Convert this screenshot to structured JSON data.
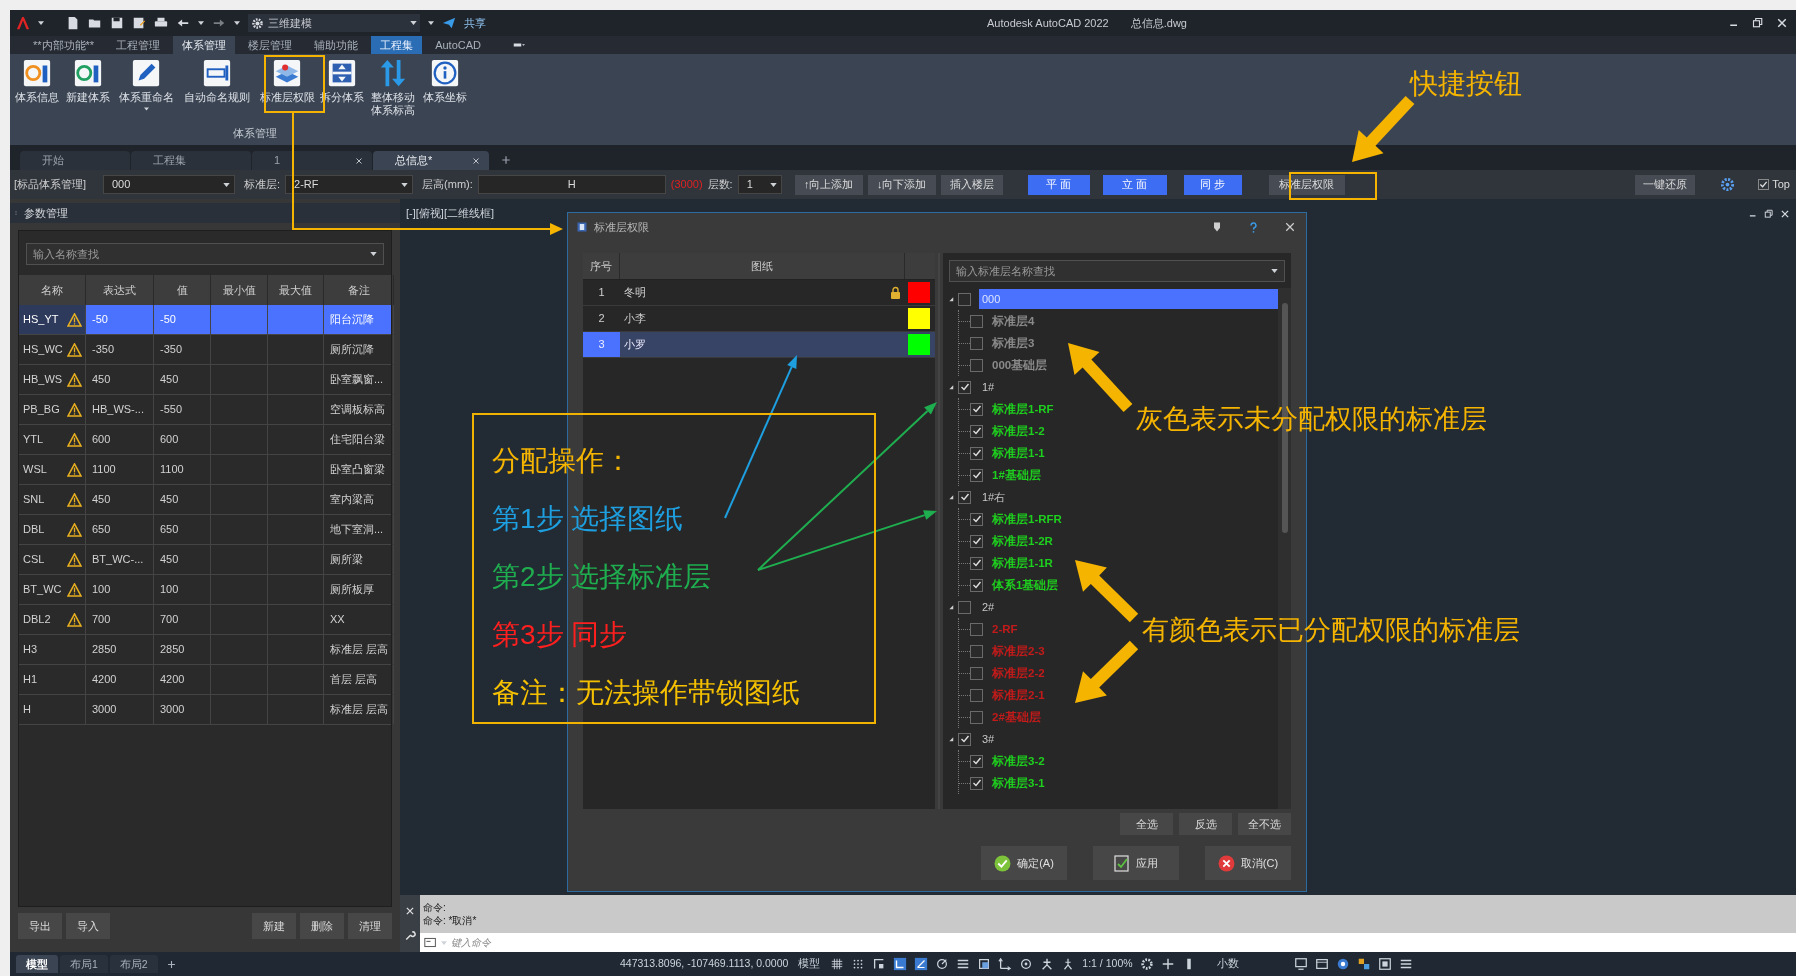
{
  "title_bar": {
    "workspace": "三维建模",
    "share": "共享",
    "title": "Autodesk AutoCAD 2022",
    "file": "总信息.dwg"
  },
  "ribbon_tabs": [
    {
      "label": "**内部功能**",
      "selected": false,
      "kind": "normal"
    },
    {
      "label": "工程管理",
      "selected": false,
      "kind": "normal"
    },
    {
      "label": "体系管理",
      "selected": true,
      "kind": "normal"
    },
    {
      "label": "楼层管理",
      "selected": false,
      "kind": "normal"
    },
    {
      "label": "辅助功能",
      "selected": false,
      "kind": "normal"
    },
    {
      "label": "工程集",
      "selected": false,
      "kind": "contextual"
    },
    {
      "label": "AutoCAD",
      "selected": false,
      "kind": "normal"
    }
  ],
  "ribbon_panel": {
    "title": "体系管理",
    "buttons": [
      {
        "label": "体系信息",
        "dropdown": false
      },
      {
        "label": "新建体系",
        "dropdown": false
      },
      {
        "label": "体系重命名",
        "dropdown": true
      },
      {
        "label": "自动命名规则",
        "dropdown": false
      },
      {
        "label": "标准层权限",
        "dropdown": false
      },
      {
        "label": "拆分体系",
        "dropdown": false
      },
      {
        "label": "整体移动体系标高",
        "dropdown": false
      },
      {
        "label": "体系坐标",
        "dropdown": false
      }
    ]
  },
  "doc_tabs": [
    {
      "label": "开始",
      "selected": false,
      "closable": false
    },
    {
      "label": "工程集",
      "selected": false,
      "closable": false
    },
    {
      "label": "1",
      "selected": false,
      "closable": true
    },
    {
      "label": "总信息*",
      "selected": true,
      "closable": true
    }
  ],
  "toolbar": {
    "system_label": "[标品体系管理]",
    "system": "000",
    "floor_label": "标准层:",
    "floor": "2-RF",
    "height_label": "层高(mm):",
    "height": "H",
    "height_value": "(3000)",
    "count_label": "层数:",
    "count": "1",
    "buttons": [
      {
        "label": "↑向上添加",
        "kind": "plain"
      },
      {
        "label": "↓向下添加",
        "kind": "plain"
      },
      {
        "label": "插入楼层",
        "kind": "plain"
      },
      {
        "label": "平 面",
        "kind": "primary"
      },
      {
        "label": "立 面",
        "kind": "primary"
      },
      {
        "label": "同 步",
        "kind": "primary"
      },
      {
        "label": "标准层权限",
        "kind": "plain"
      }
    ],
    "reset": "一键还原",
    "top": {
      "label": "Top",
      "checked": true
    }
  },
  "params": {
    "title": "参数管理",
    "search_placeholder": "输入名称查找",
    "columns": [
      "名称",
      "表达式",
      "值",
      "最小值",
      "最大值",
      "备注"
    ],
    "rows": [
      {
        "name": "HS_YT",
        "warning": true,
        "expression": "-50",
        "value": "-50",
        "note": "阳台沉降",
        "selected": true
      },
      {
        "name": "HS_WC",
        "warning": true,
        "expression": "-350",
        "value": "-350",
        "note": "厕所沉降",
        "selected": false
      },
      {
        "name": "HB_WS",
        "warning": true,
        "expression": "450",
        "value": "450",
        "note": "卧室飘窗...",
        "selected": false
      },
      {
        "name": "PB_BG",
        "warning": true,
        "expression": "HB_WS-...",
        "value": "-550",
        "note": "空调板标高",
        "selected": false
      },
      {
        "name": "YTL",
        "warning": true,
        "expression": "600",
        "value": "600",
        "note": "住宅阳台梁",
        "selected": false
      },
      {
        "name": "WSL",
        "warning": true,
        "expression": "1100",
        "value": "1100",
        "note": "卧室凸窗梁",
        "selected": false
      },
      {
        "name": "SNL",
        "warning": true,
        "expression": "450",
        "value": "450",
        "note": "室内梁高",
        "selected": false
      },
      {
        "name": "DBL",
        "warning": true,
        "expression": "650",
        "value": "650",
        "note": "地下室洞...",
        "selected": false
      },
      {
        "name": "CSL",
        "warning": true,
        "expression": "BT_WC-...",
        "value": "450",
        "note": "厕所梁",
        "selected": false
      },
      {
        "name": "BT_WC",
        "warning": true,
        "expression": "100",
        "value": "100",
        "note": "厕所板厚",
        "selected": false
      },
      {
        "name": "DBL2",
        "warning": true,
        "expression": "700",
        "value": "700",
        "note": "XX",
        "selected": false
      },
      {
        "name": "H3",
        "warning": false,
        "expression": "2850",
        "value": "2850",
        "note": "标准层 层高",
        "selected": false
      },
      {
        "name": "H1",
        "warning": false,
        "expression": "4200",
        "value": "4200",
        "note": "首层 层高",
        "selected": false
      },
      {
        "name": "H",
        "warning": false,
        "expression": "3000",
        "value": "3000",
        "note": "标准层 层高",
        "selected": false
      }
    ],
    "buttons_left": [
      "导出",
      "导入"
    ],
    "buttons_right": [
      "新建",
      "删除",
      "清理"
    ]
  },
  "layout_tabs": [
    {
      "label": "模型",
      "selected": true
    },
    {
      "label": "布局1",
      "selected": false
    },
    {
      "label": "布局2",
      "selected": false
    }
  ],
  "viewport": {
    "label": "[-][俯视][二维线框]"
  },
  "dialog": {
    "title": "标准层权限",
    "columns": [
      "序号",
      "图纸"
    ],
    "drawings": [
      {
        "index": "1",
        "name": "冬明",
        "locked": true,
        "color": "#ff0000",
        "selected": false
      },
      {
        "index": "2",
        "name": "小李",
        "locked": false,
        "color": "#ffff00",
        "selected": false
      },
      {
        "index": "3",
        "name": "小罗",
        "locked": false,
        "color": "#00ff00",
        "selected": true
      }
    ],
    "tree_placeholder": "输入标准层名称查找",
    "tree": [
      {
        "label": "000",
        "checked": false,
        "selected": true,
        "children": [
          {
            "label": "标准层4",
            "checked": false,
            "selected": false,
            "color": "#8a8a8a"
          },
          {
            "label": "标准层3",
            "checked": false,
            "selected": false,
            "color": "#8a8a8a"
          },
          {
            "label": "000基础层",
            "checked": false,
            "selected": false,
            "color": "#8a8a8a"
          }
        ]
      },
      {
        "label": "1#",
        "checked": true,
        "selected": false,
        "children": [
          {
            "label": "标准层1-RF",
            "checked": true,
            "selected": false,
            "color": "#1ed01e"
          },
          {
            "label": "标准层1-2",
            "checked": true,
            "selected": false,
            "color": "#1ed01e"
          },
          {
            "label": "标准层1-1",
            "checked": true,
            "selected": false,
            "color": "#1ed01e"
          },
          {
            "label": "1#基础层",
            "checked": true,
            "selected": false,
            "color": "#1ed01e"
          }
        ]
      },
      {
        "label": "1#右",
        "checked": true,
        "selected": false,
        "children": [
          {
            "label": "标准层1-RFR",
            "checked": true,
            "selected": false,
            "color": "#1ed01e"
          },
          {
            "label": "标准层1-2R",
            "checked": true,
            "selected": false,
            "color": "#1ed01e"
          },
          {
            "label": "标准层1-1R",
            "checked": true,
            "selected": false,
            "color": "#1ed01e"
          },
          {
            "label": "体系1基础层",
            "checked": true,
            "selected": false,
            "color": "#1ed01e"
          }
        ]
      },
      {
        "label": "2#",
        "checked": false,
        "selected": false,
        "children": [
          {
            "label": "2-RF",
            "checked": false,
            "selected": false,
            "color": "#c41a1a"
          },
          {
            "label": "标准层2-3",
            "checked": false,
            "selected": false,
            "color": "#c41a1a"
          },
          {
            "label": "标准层2-2",
            "checked": false,
            "selected": false,
            "color": "#c41a1a"
          },
          {
            "label": "标准层2-1",
            "checked": false,
            "selected": false,
            "color": "#c41a1a"
          },
          {
            "label": "2#基础层",
            "checked": false,
            "selected": false,
            "color": "#c41a1a"
          }
        ]
      },
      {
        "label": "3#",
        "checked": true,
        "selected": false,
        "children": [
          {
            "label": "标准层3-2",
            "checked": true,
            "selected": false,
            "color": "#1ed01e"
          },
          {
            "label": "标准层3-1",
            "checked": true,
            "selected": false,
            "color": "#1ed01e"
          }
        ]
      }
    ],
    "select_buttons": [
      "全选",
      "反选",
      "全不选"
    ],
    "buttons": [
      {
        "label": "确定(A)",
        "kind": "ok"
      },
      {
        "label": "应用",
        "kind": "apply"
      },
      {
        "label": "取消(C)",
        "kind": "cancel"
      }
    ]
  },
  "command": {
    "lines": [
      "命令:",
      "命令: *取消*"
    ],
    "placeholder": "键入命令"
  },
  "status_bar": {
    "coords": "447313.8096, -107469.1113, 0.0000",
    "space": "模型",
    "scale": "1:1 / 100%",
    "units": "小数"
  },
  "annotations": {
    "callout": "快捷按钮",
    "steps": [
      {
        "text": "分配操作：",
        "color": "#f5b400"
      },
      {
        "text": "第1步 选择图纸",
        "color": "#1e9fe0"
      },
      {
        "text": "第2步 选择标准层",
        "color": "#1fae4f"
      },
      {
        "text": "第3步 同步",
        "color": "#ff1f1f"
      },
      {
        "text": "备注：无法操作带锁图纸",
        "color": "#f5c000"
      }
    ],
    "notes": [
      "灰色表示未分配权限的标准层",
      "有颜色表示已分配权限的标准层"
    ]
  }
}
